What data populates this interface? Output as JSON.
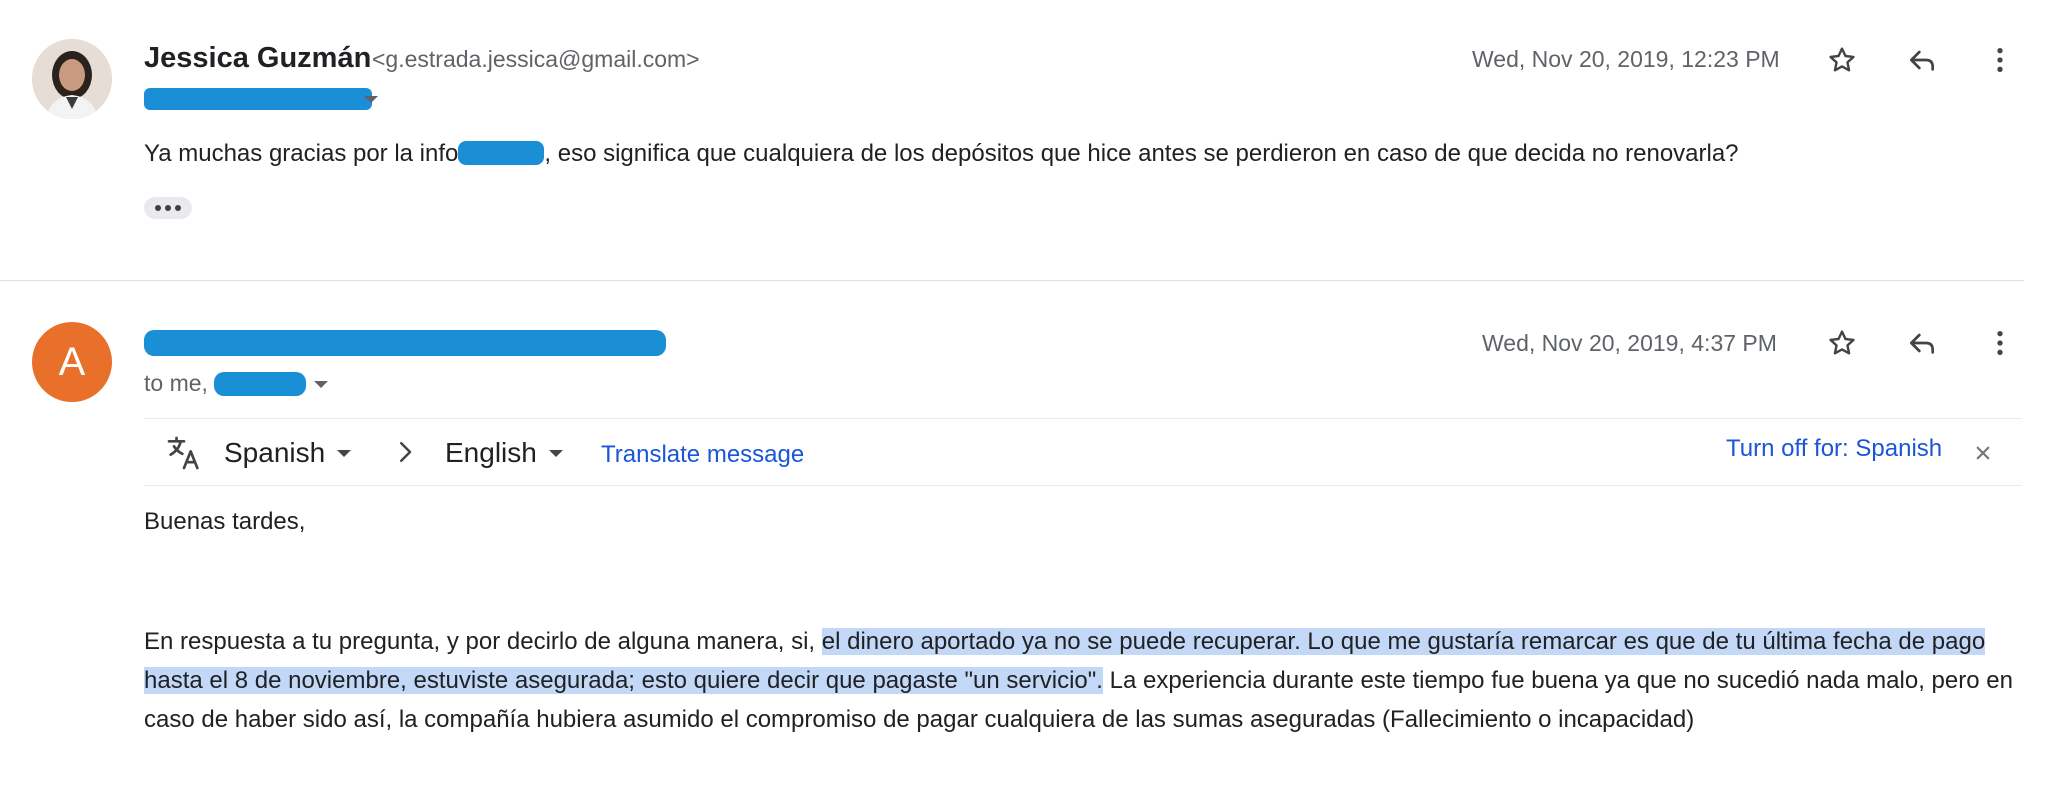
{
  "message1": {
    "sender_name": "Jessica Guzmán",
    "sender_email": "<g.estrada.jessica@gmail.com>",
    "date": "Wed, Nov 20, 2019, 12:23 PM",
    "body_before": "Ya muchas gracias por la info",
    "body_after": ", eso significa que cualquiera de los depósitos que hice antes se perdieron en caso de que decida no renovarla?"
  },
  "message2": {
    "avatar_letter": "A",
    "to_prefix": "to me,",
    "date": "Wed, Nov 20, 2019, 4:37 PM",
    "translate_bar": {
      "from_language": "Spanish",
      "to_language": "English",
      "translate_link": "Translate message",
      "turn_off_link": "Turn off for: Spanish"
    },
    "greeting": "Buenas tardes,",
    "paragraph": {
      "before": "En respuesta a tu pregunta, y por decirlo de alguna manera, si, ",
      "highlighted": "el dinero aportado ya no se puede recuperar. Lo que me gustaría remarcar es que de tu última fecha de pago hasta el 8 de noviembre, estuviste asegurada; esto quiere decir que pagaste \"un servicio\".",
      "after": " La experiencia durante este tiempo fue buena ya que no sucedió nada malo, pero en caso de haber sido así, la compañía hubiera asumido el compromiso de pagar cualquiera de las sumas aseguradas (Fallecimiento o incapacidad)"
    }
  },
  "colors": {
    "redaction": "#1a8fd6",
    "highlight": "#c3d8f7",
    "link": "#1a56d6",
    "avatar_orange": "#e8702a"
  },
  "icons": [
    "star-icon",
    "reply-icon",
    "more-vert-icon",
    "translate-icon",
    "chevron-right-icon",
    "close-icon",
    "caret-down-icon"
  ]
}
